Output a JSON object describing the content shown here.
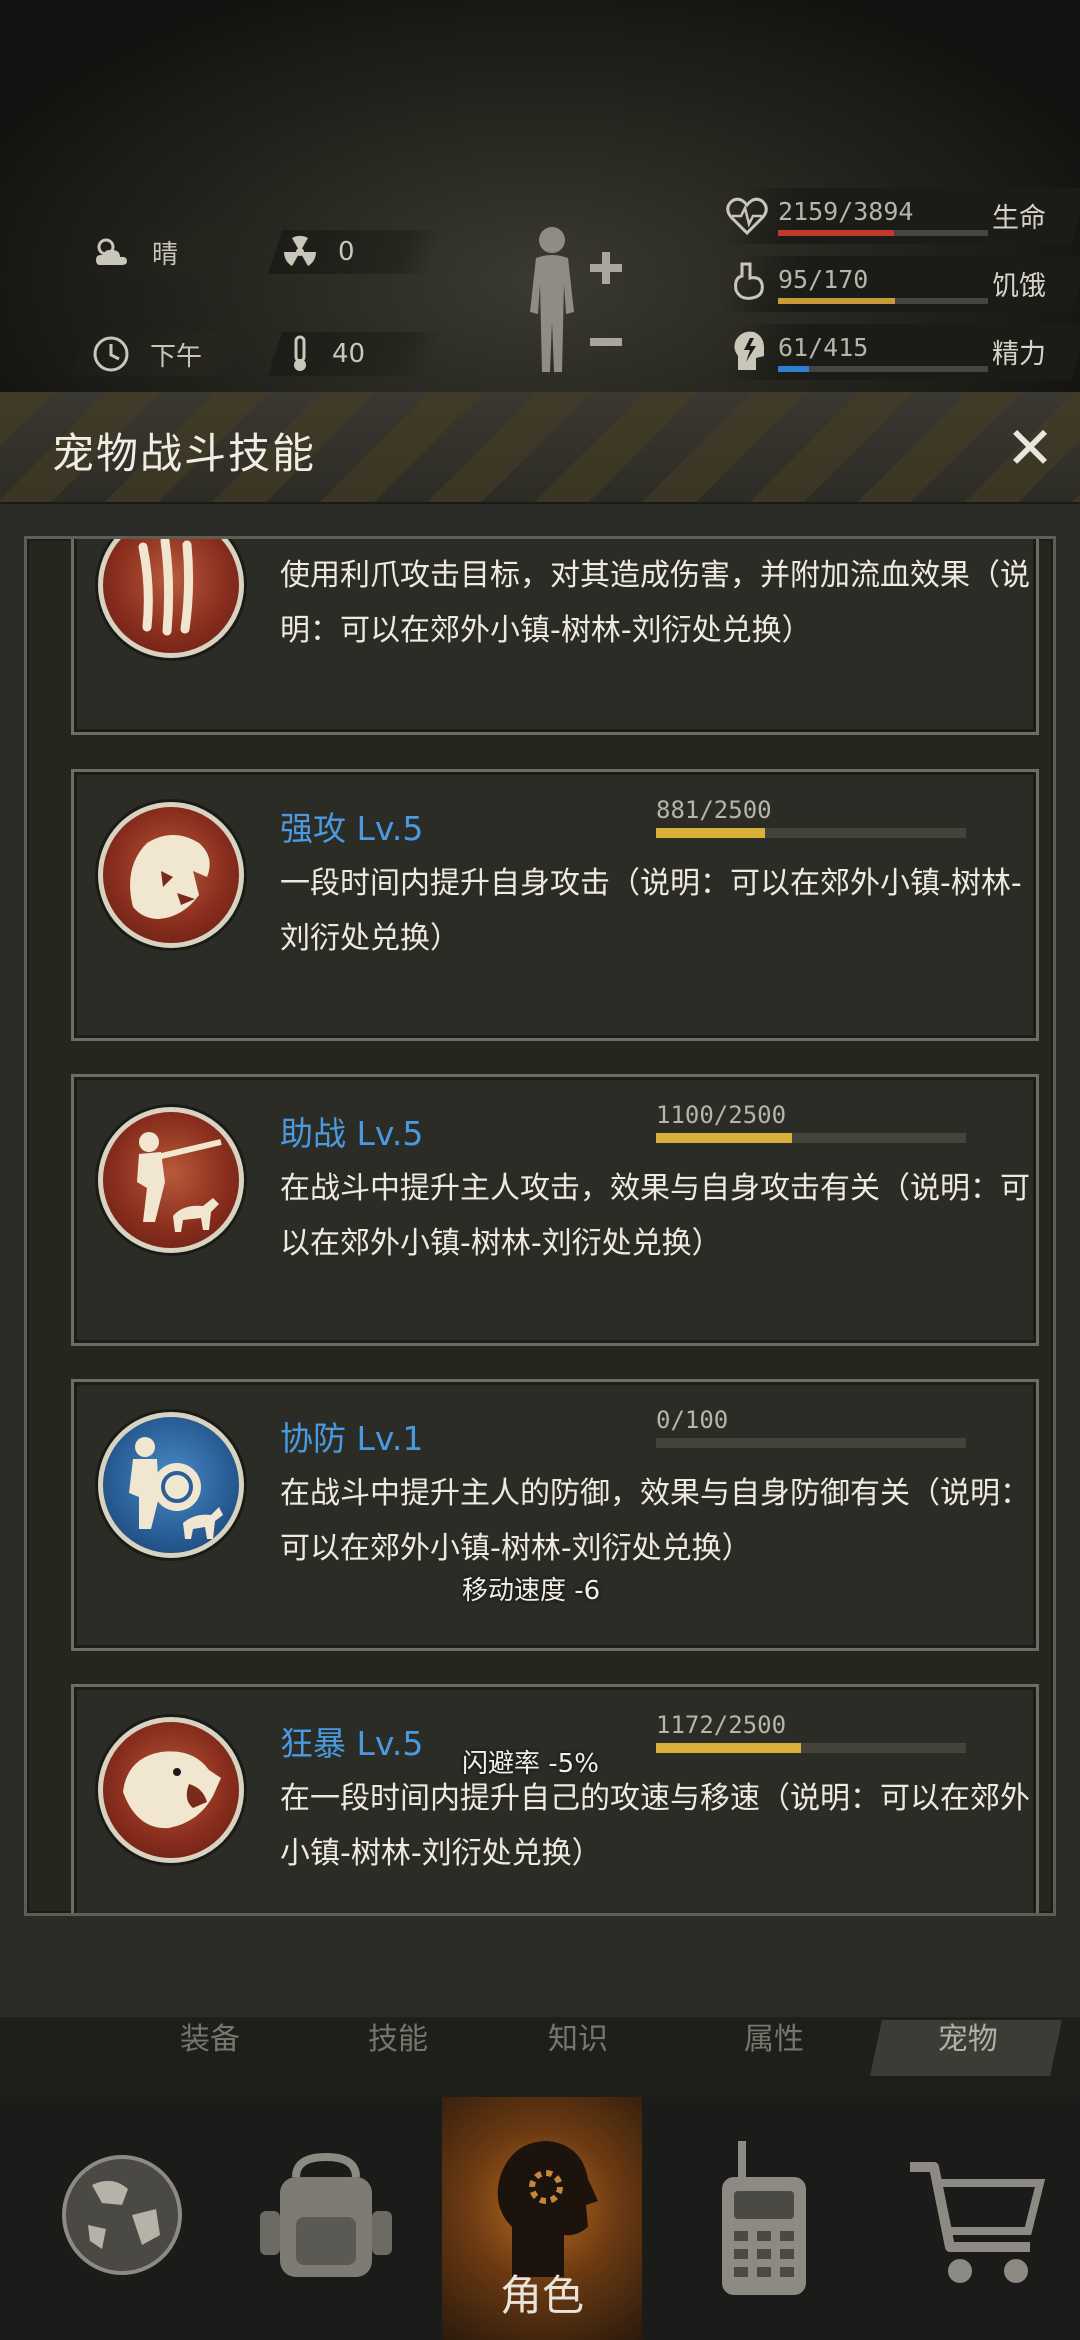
{
  "status": {
    "weather": "晴",
    "radiation": "0",
    "time_of_day": "下午",
    "temperature": "40",
    "life": {
      "label": "生命",
      "value": "2159/3894",
      "fraction": 0.554,
      "color": "#c0392b"
    },
    "hunger": {
      "label": "饥饿",
      "value": "95/170",
      "fraction": 0.559,
      "color": "#c89a3a"
    },
    "energy": {
      "label": "精力",
      "value": "61/415",
      "fraction": 0.147,
      "color": "#2f7fd0"
    }
  },
  "panel": {
    "title": "宠物战斗技能",
    "close_glyph": "✕",
    "partial_skill": {
      "description": "使用利爪攻击目标，对其造成伤害，并附加流血效果（说明：可以在郊外小镇-树林-刘衍处兑换）"
    },
    "skills": [
      {
        "name": "强攻 Lv.5",
        "xp": "881/2500",
        "fraction": 0.352,
        "description": "一段时间内提升自身攻击（说明：可以在郊外小镇-树林-刘衍处兑换）",
        "icon": "beast-attack-icon",
        "tone": "red"
      },
      {
        "name": "助战 Lv.5",
        "xp": "1100/2500",
        "fraction": 0.44,
        "description": "在战斗中提升主人攻击，效果与自身攻击有关（说明：可以在郊外小镇-树林-刘衍处兑换）",
        "icon": "hunter-dog-icon",
        "tone": "red"
      },
      {
        "name": "协防 Lv.1",
        "xp": "0/100",
        "fraction": 0.0,
        "description": "在战斗中提升主人的防御，效果与自身防御有关（说明：可以在郊外小镇-树林-刘衍处兑换）",
        "icon": "shield-dog-icon",
        "tone": "blue"
      },
      {
        "name": "狂暴 Lv.5",
        "xp": "1172/2500",
        "fraction": 0.469,
        "description": "在一段时间内提升自己的攻速与移速（说明：可以在郊外小镇-树林-刘衍处兑换）",
        "icon": "roaring-bear-icon",
        "tone": "red"
      }
    ],
    "floating_effects": [
      "移动速度 -6",
      "闪避率 -5%"
    ]
  },
  "sub_tabs": [
    {
      "label": "装备",
      "active": false
    },
    {
      "label": "技能",
      "active": false
    },
    {
      "label": "知识",
      "active": false
    },
    {
      "label": "属性",
      "active": false
    },
    {
      "label": "宠物",
      "active": true
    }
  ],
  "bottom_nav": {
    "items": [
      "globe-icon",
      "backpack-icon",
      "role-icon",
      "radio-icon",
      "cart-icon"
    ],
    "active_label": "角色"
  }
}
